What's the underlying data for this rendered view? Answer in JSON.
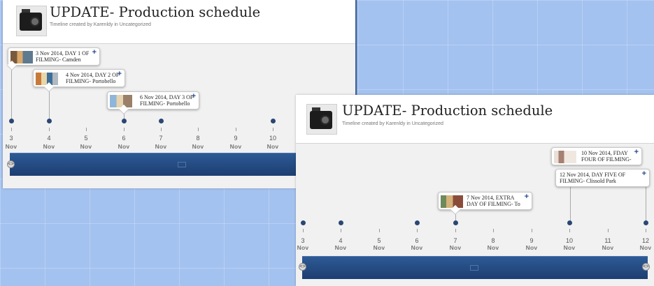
{
  "left_screenshot": {
    "title": "UPDATE- Production schedule",
    "byline": "Timeline created by Karenldy in Uncategorized",
    "events": [
      {
        "line1": "3 Nov 2014, DAY 1 OF",
        "line2": "FILMING- Camden",
        "plus": "+"
      },
      {
        "line1": "4 Nov 2014, DAY 2 OF",
        "line2": "FILMING- Portobello",
        "plus": "+"
      },
      {
        "line1": "6 Nov 2014, DAY 3 OF",
        "line2": "FILMING- Portobello",
        "plus": "+"
      }
    ],
    "ticks": [
      {
        "day": "3",
        "month": "Nov"
      },
      {
        "day": "4",
        "month": "Nov"
      },
      {
        "day": "5",
        "month": "Nov"
      },
      {
        "day": "6",
        "month": "Nov"
      },
      {
        "day": "7",
        "month": "Nov"
      },
      {
        "day": "8",
        "month": "Nov"
      },
      {
        "day": "9",
        "month": "Nov"
      },
      {
        "day": "10",
        "month": "Nov"
      }
    ],
    "handle_glyph": "<>"
  },
  "right_screenshot": {
    "title": "UPDATE- Production schedule",
    "byline": "Timeline created by Karenldy in Uncategorized",
    "events": [
      {
        "line1": "7 Nov 2014, EXTRA",
        "line2": "DAY OF FILMING- To",
        "plus": "+"
      },
      {
        "line1": "10 Nov 2014, FDAY",
        "line2": "FOUR OF FILMING-",
        "plus": "+"
      },
      {
        "line1": "12 Nov 2014, DAY FIVE OF",
        "line2": "FILMING- Clissold Park",
        "plus": "+"
      }
    ],
    "ticks": [
      {
        "day": "3",
        "month": "Nov"
      },
      {
        "day": "4",
        "month": "Nov"
      },
      {
        "day": "5",
        "month": "Nov"
      },
      {
        "day": "6",
        "month": "Nov"
      },
      {
        "day": "7",
        "month": "Nov"
      },
      {
        "day": "8",
        "month": "Nov"
      },
      {
        "day": "9",
        "month": "Nov"
      },
      {
        "day": "10",
        "month": "Nov"
      },
      {
        "day": "11",
        "month": "Nov"
      },
      {
        "day": "12",
        "month": "Nov"
      }
    ],
    "handle_glyph": "<>"
  },
  "colors": {
    "desktop_bg": "#a4c2ef",
    "timeline_bar": "#23467d",
    "marker_dot": "#2a4774",
    "plus_accent": "#2a4c8a"
  }
}
